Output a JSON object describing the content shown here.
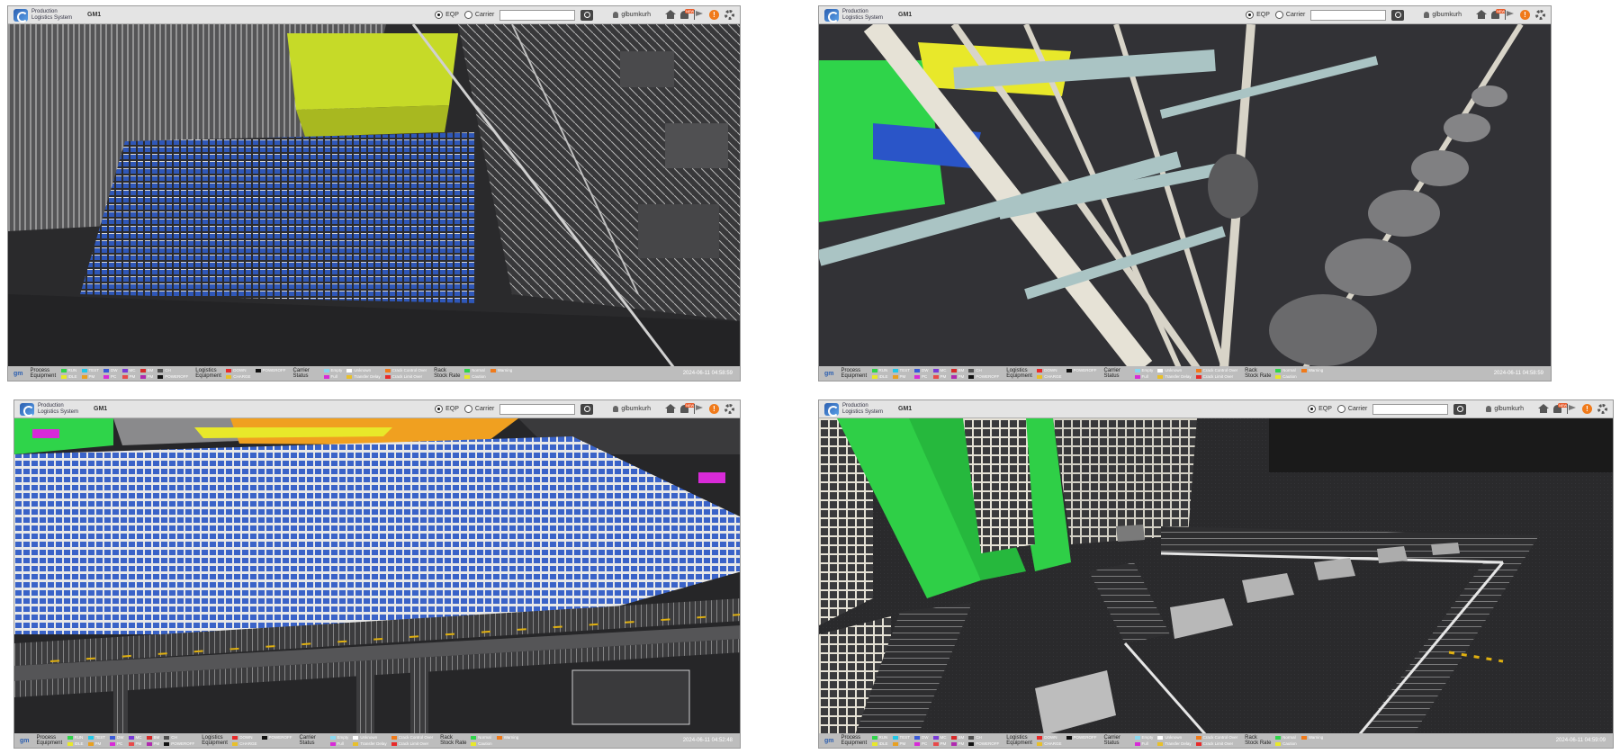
{
  "app": {
    "name_line1": "Production",
    "name_line2": "Logistics System",
    "site": "GM1"
  },
  "topbar": {
    "radio_eqp": "EQP",
    "radio_carrier": "Carrier",
    "search_value": "",
    "username": "glbumkurh",
    "new_badge": "NEW",
    "info_glyph": "!"
  },
  "legend": {
    "logo_text": "gm",
    "process": {
      "title_line1": "Process",
      "title_line2": "Equipment",
      "items": [
        {
          "label": "RUN",
          "color": "#2fd44a"
        },
        {
          "label": "IDLE",
          "color": "#e8e82a"
        },
        {
          "label": "TEST",
          "color": "#22c8e8"
        },
        {
          "label": "PM",
          "color": "#e8a020"
        },
        {
          "label": "DW",
          "color": "#3a5ad8"
        },
        {
          "label": "PC",
          "color": "#d82ad8"
        },
        {
          "label": "MC",
          "color": "#7a3ad8"
        },
        {
          "label": "PM",
          "color": "#e84a4a"
        },
        {
          "label": "BM",
          "color": "#d82a2a"
        },
        {
          "label": "PM",
          "color": "#b02ab0"
        },
        {
          "label": "CH",
          "color": "#505050"
        },
        {
          "label": "POWEROFF",
          "color": "#111111"
        }
      ]
    },
    "logistics": {
      "title_line1": "Logistics",
      "title_line2": "Equipment",
      "items": [
        {
          "label": "DOWN",
          "color": "#e82a2a"
        },
        {
          "label": "CHARGE",
          "color": "#e8c02a"
        },
        {
          "label": "POWEROFF",
          "color": "#111111"
        }
      ]
    },
    "carrier": {
      "title_line1": "Carrier",
      "title_line2": "Status",
      "items": [
        {
          "label": "Empty",
          "color": "#8ad8f0"
        },
        {
          "label": "Full",
          "color": "#d82ad8"
        },
        {
          "label": "Unknown",
          "color": "#ffffff"
        },
        {
          "label": "Transfer Delay",
          "color": "#e8c02a"
        },
        {
          "label": "Crack Control Over",
          "color": "#f07a1a"
        },
        {
          "label": "Crack Limit Over",
          "color": "#e82a2a"
        }
      ]
    },
    "rack": {
      "title_line1": "Rack",
      "title_line2": "Stock Rate",
      "items": [
        {
          "label": "Normal",
          "color": "#2fd44a"
        },
        {
          "label": "Caution",
          "color": "#e8e82a"
        },
        {
          "label": "Warning",
          "color": "#f07a1a"
        }
      ]
    }
  },
  "panels": [
    {
      "timestamp": "2024-06-11 04:58:59"
    },
    {
      "timestamp": "2024-06-11 04:58:59"
    },
    {
      "timestamp": "2024-06-11 04:52:48"
    },
    {
      "timestamp": "2024-06-11 04:59:09"
    }
  ]
}
